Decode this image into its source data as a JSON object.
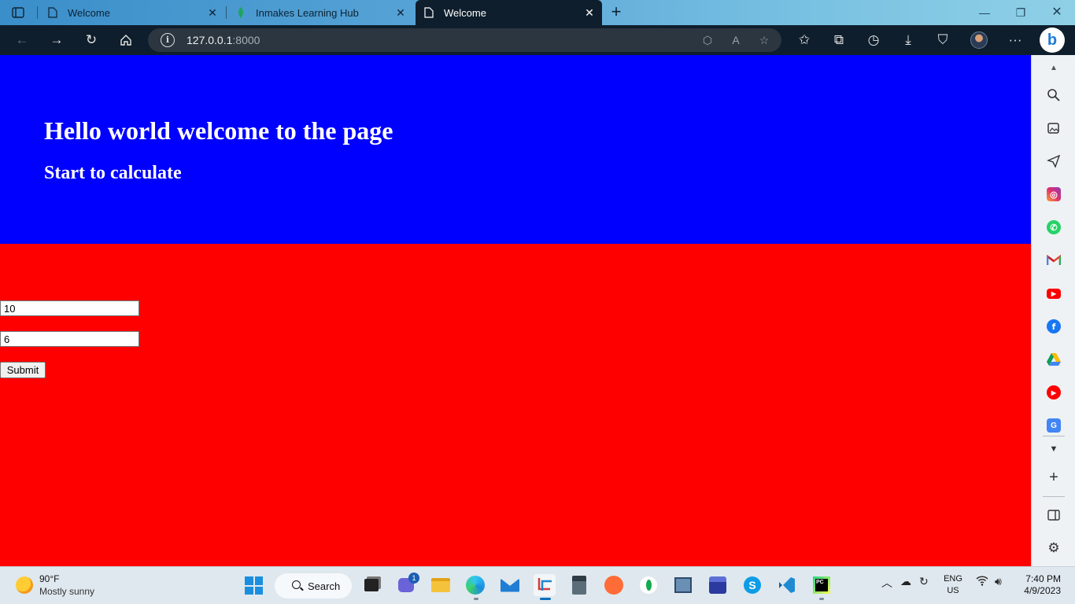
{
  "browser": {
    "tabs": [
      {
        "title": "Welcome",
        "active": false
      },
      {
        "title": "Inmakes Learning Hub",
        "active": false
      },
      {
        "title": "Welcome",
        "active": true
      }
    ],
    "address": {
      "host": "127.0.0.1",
      "port": ":8000"
    }
  },
  "page": {
    "heading": "Hello world welcome to the page",
    "subheading": "Start to calculate",
    "form": {
      "input1_value": "10",
      "input2_value": "6",
      "submit_label": "Submit"
    },
    "colors": {
      "banner": "#0000ff",
      "body": "#ff0000"
    }
  },
  "taskbar": {
    "weather": {
      "temp": "90°F",
      "desc": "Mostly sunny"
    },
    "search_label": "Search",
    "teams_badge": "1",
    "lang_line1": "ENG",
    "lang_line2": "US",
    "time": "7:40 PM",
    "date": "4/9/2023"
  },
  "icons": {
    "sidebar": [
      "scroll-up-icon",
      "search-zoom-icon",
      "image-edit-icon",
      "send-icon",
      "instagram-icon",
      "whatsapp-icon",
      "gmail-icon",
      "youtube-icon",
      "facebook-icon",
      "google-drive-icon",
      "youtube-music-icon",
      "google-translate-icon",
      "chevron-down-icon",
      "add-icon",
      "sidebar-toggle-icon",
      "settings-icon"
    ]
  }
}
